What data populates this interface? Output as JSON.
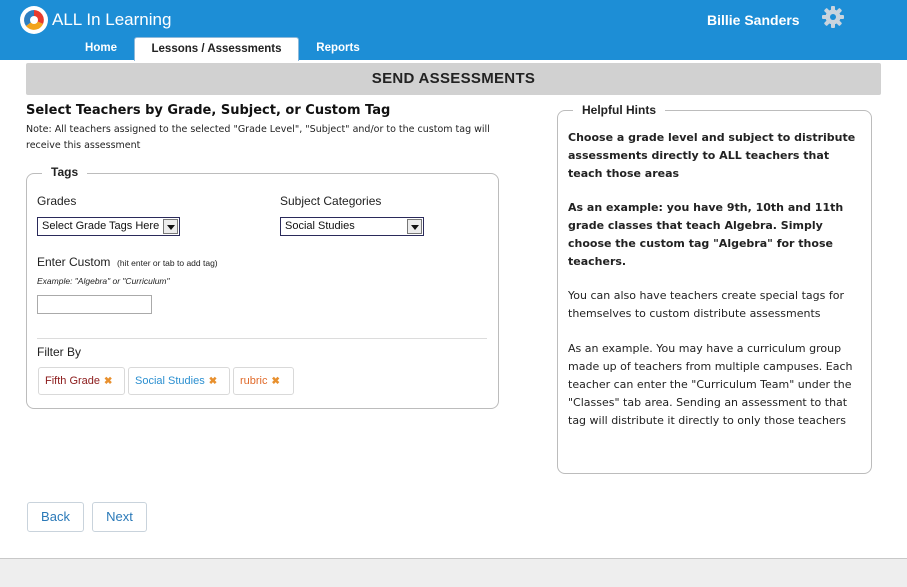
{
  "header": {
    "app_name": "ALL In Learning",
    "user_name": "Billie Sanders",
    "nav_tabs": [
      {
        "label": "Home"
      },
      {
        "label": "Lessons / Assessments",
        "active": true
      },
      {
        "label": "Reports"
      }
    ],
    "brand_color": "#1d8ed6",
    "icons": [
      "logo-icon",
      "gear-icon"
    ]
  },
  "page_title": "SEND ASSESSMENTS",
  "section_heading": "Select Teachers by Grade, Subject, or Custom Tag",
  "note": "Note: All teachers assigned to the selected \"Grade Level\", \"Subject\" and/or to the custom tag will receive this assessment",
  "tags": {
    "legend": "Tags",
    "grades_label": "Grades",
    "grades_select_value": "Select Grade Tags Here",
    "subject_label": "Subject Categories",
    "subject_select_value": "Social Studies",
    "custom_label": "Enter Custom",
    "custom_hint": "(hit enter or tab to add tag)",
    "custom_example": "Example: \"Algebra\" or \"Curriculum\"",
    "custom_value": "",
    "filter_label": "Filter By",
    "filters": [
      {
        "label": "Fifth Grade",
        "remove": "✖"
      },
      {
        "label": "Social Studies",
        "remove": "✖"
      },
      {
        "label": "rubric",
        "remove": "✖"
      }
    ]
  },
  "hints": {
    "legend": "Helpful Hints",
    "paragraphs": [
      "Choose a grade level and subject to distribute assessments directly to ALL teachers that teach those areas",
      "As an example: you have 9th, 10th and 11th grade classes that teach Algebra. Simply choose the custom tag \"Algebra\" for those teachers.",
      "You can also have teachers create special tags for themselves to custom distribute assessments",
      "As an example. You may have a curriculum group made up of teachers from multiple campuses. Each teacher can enter the \"Curriculum Team\" under the \"Classes\" tab area. Sending an assessment to that tag will distribute it directly to only those teachers"
    ]
  },
  "buttons": {
    "back": "Back",
    "next": "Next"
  }
}
